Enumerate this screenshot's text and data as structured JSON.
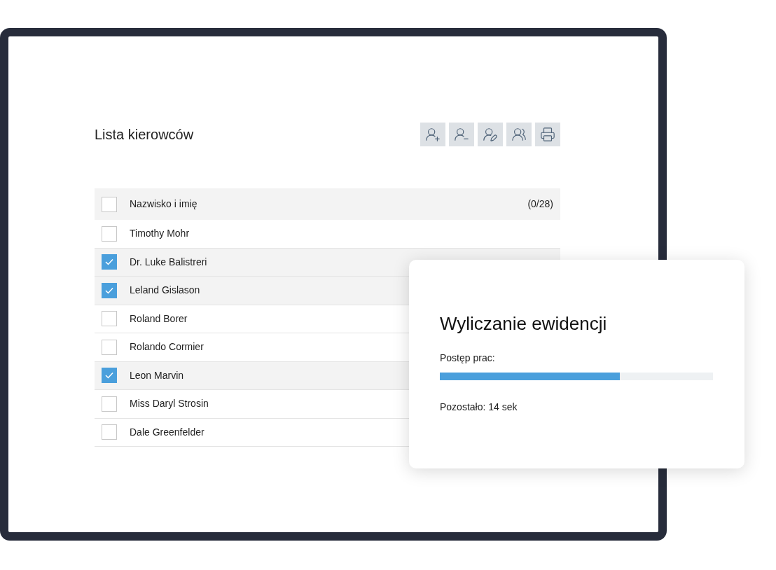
{
  "title": "Lista kierowców",
  "toolbar": [
    {
      "kind": "add"
    },
    {
      "kind": "remove"
    },
    {
      "kind": "edit"
    },
    {
      "kind": "group"
    },
    {
      "kind": "print"
    }
  ],
  "table": {
    "header": {
      "label": "Nazwisko i imię",
      "count": "(0/28)",
      "checked": false
    },
    "rows": [
      {
        "name": "Timothy Mohr",
        "checked": false
      },
      {
        "name": "Dr. Luke Balistreri",
        "checked": true
      },
      {
        "name": "Leland Gislason",
        "checked": true
      },
      {
        "name": "Roland Borer",
        "checked": false
      },
      {
        "name": "Rolando Cormier",
        "checked": false
      },
      {
        "name": "Leon Marvin",
        "checked": true
      },
      {
        "name": "Miss Daryl Strosin",
        "checked": false
      },
      {
        "name": "Dale Greenfelder",
        "checked": false
      }
    ]
  },
  "dialog": {
    "title": "Wyliczanie ewidencji",
    "progress_label": "Postęp prac:",
    "level": 0.66,
    "remaining": "Pozostało: 14 sek"
  }
}
